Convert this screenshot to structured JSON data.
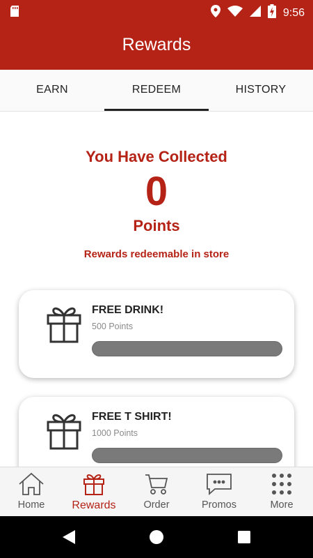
{
  "status_bar": {
    "time": "9:56",
    "icons": [
      "sd-card-icon",
      "location-icon",
      "wifi-icon",
      "signal-icon",
      "battery-charging-icon"
    ]
  },
  "app_bar": {
    "title": "Rewards"
  },
  "tabs": [
    {
      "label": "EARN",
      "active": false
    },
    {
      "label": "REDEEM",
      "active": true
    },
    {
      "label": "HISTORY",
      "active": false
    }
  ],
  "summary": {
    "heading": "You Have Collected",
    "points": "0",
    "points_label": "Points",
    "note": "Rewards redeemable in store"
  },
  "rewards": [
    {
      "name": "FREE DRINK!",
      "cost": "500 Points",
      "progress": 0,
      "icon": "gift-icon"
    },
    {
      "name": "FREE T SHIRT!",
      "cost": "1000 Points",
      "progress": 0,
      "icon": "gift-icon"
    }
  ],
  "bottom_nav": [
    {
      "label": "Home",
      "icon": "home-icon",
      "active": false
    },
    {
      "label": "Rewards",
      "icon": "gift-icon",
      "active": true
    },
    {
      "label": "Order",
      "icon": "cart-icon",
      "active": false
    },
    {
      "label": "Promos",
      "icon": "chat-bubble-icon",
      "active": false
    },
    {
      "label": "More",
      "icon": "grid-dots-icon",
      "active": false
    }
  ],
  "colors": {
    "brand": "#b52216",
    "progress_track": "#7a7a7a"
  }
}
